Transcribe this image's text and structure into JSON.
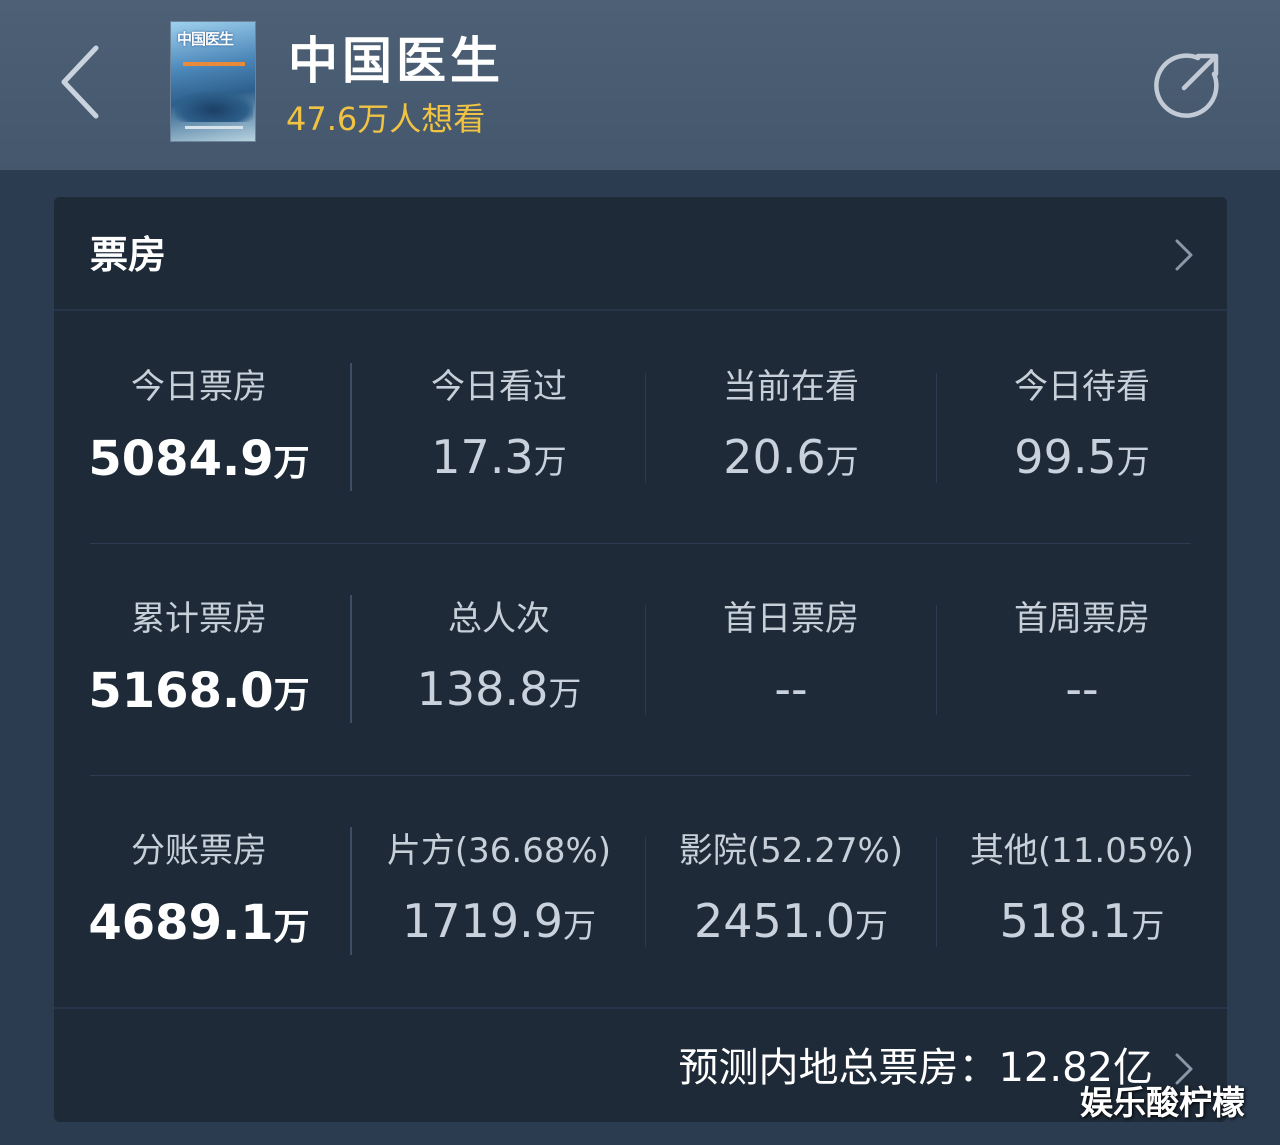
{
  "header": {
    "title": "中国医生",
    "want_to_see": "47.6万人想看",
    "poster_title": "中国医生",
    "back_icon": "chevron-left-icon",
    "share_icon": "share-icon"
  },
  "card": {
    "title": "票房",
    "rows": [
      {
        "cells": [
          {
            "label": "今日票房",
            "value": "5084.9",
            "unit": "万"
          },
          {
            "label": "今日看过",
            "value": "17.3",
            "unit": "万"
          },
          {
            "label": "当前在看",
            "value": "20.6",
            "unit": "万"
          },
          {
            "label": "今日待看",
            "value": "99.5",
            "unit": "万"
          }
        ]
      },
      {
        "cells": [
          {
            "label": "累计票房",
            "value": "5168.0",
            "unit": "万"
          },
          {
            "label": "总人次",
            "value": "138.8",
            "unit": "万"
          },
          {
            "label": "首日票房",
            "value": "--",
            "unit": ""
          },
          {
            "label": "首周票房",
            "value": "--",
            "unit": ""
          }
        ]
      },
      {
        "cells": [
          {
            "label": "分账票房",
            "value": "4689.1",
            "unit": "万"
          },
          {
            "label": "片方(36.68%)",
            "value": "1719.9",
            "unit": "万"
          },
          {
            "label": "影院(52.27%)",
            "value": "2451.0",
            "unit": "万"
          },
          {
            "label": "其他(11.05%)",
            "value": "518.1",
            "unit": "万"
          }
        ]
      }
    ],
    "predict": "预测内地总票房：12.82亿"
  },
  "watermark": "娱乐酸柠檬",
  "colors": {
    "header_bg": "#4a5d73",
    "page_bg": "#2b3b50",
    "card_bg": "#1e2a38",
    "want_accent": "#f1c343",
    "text_primary": "#ffffff"
  }
}
